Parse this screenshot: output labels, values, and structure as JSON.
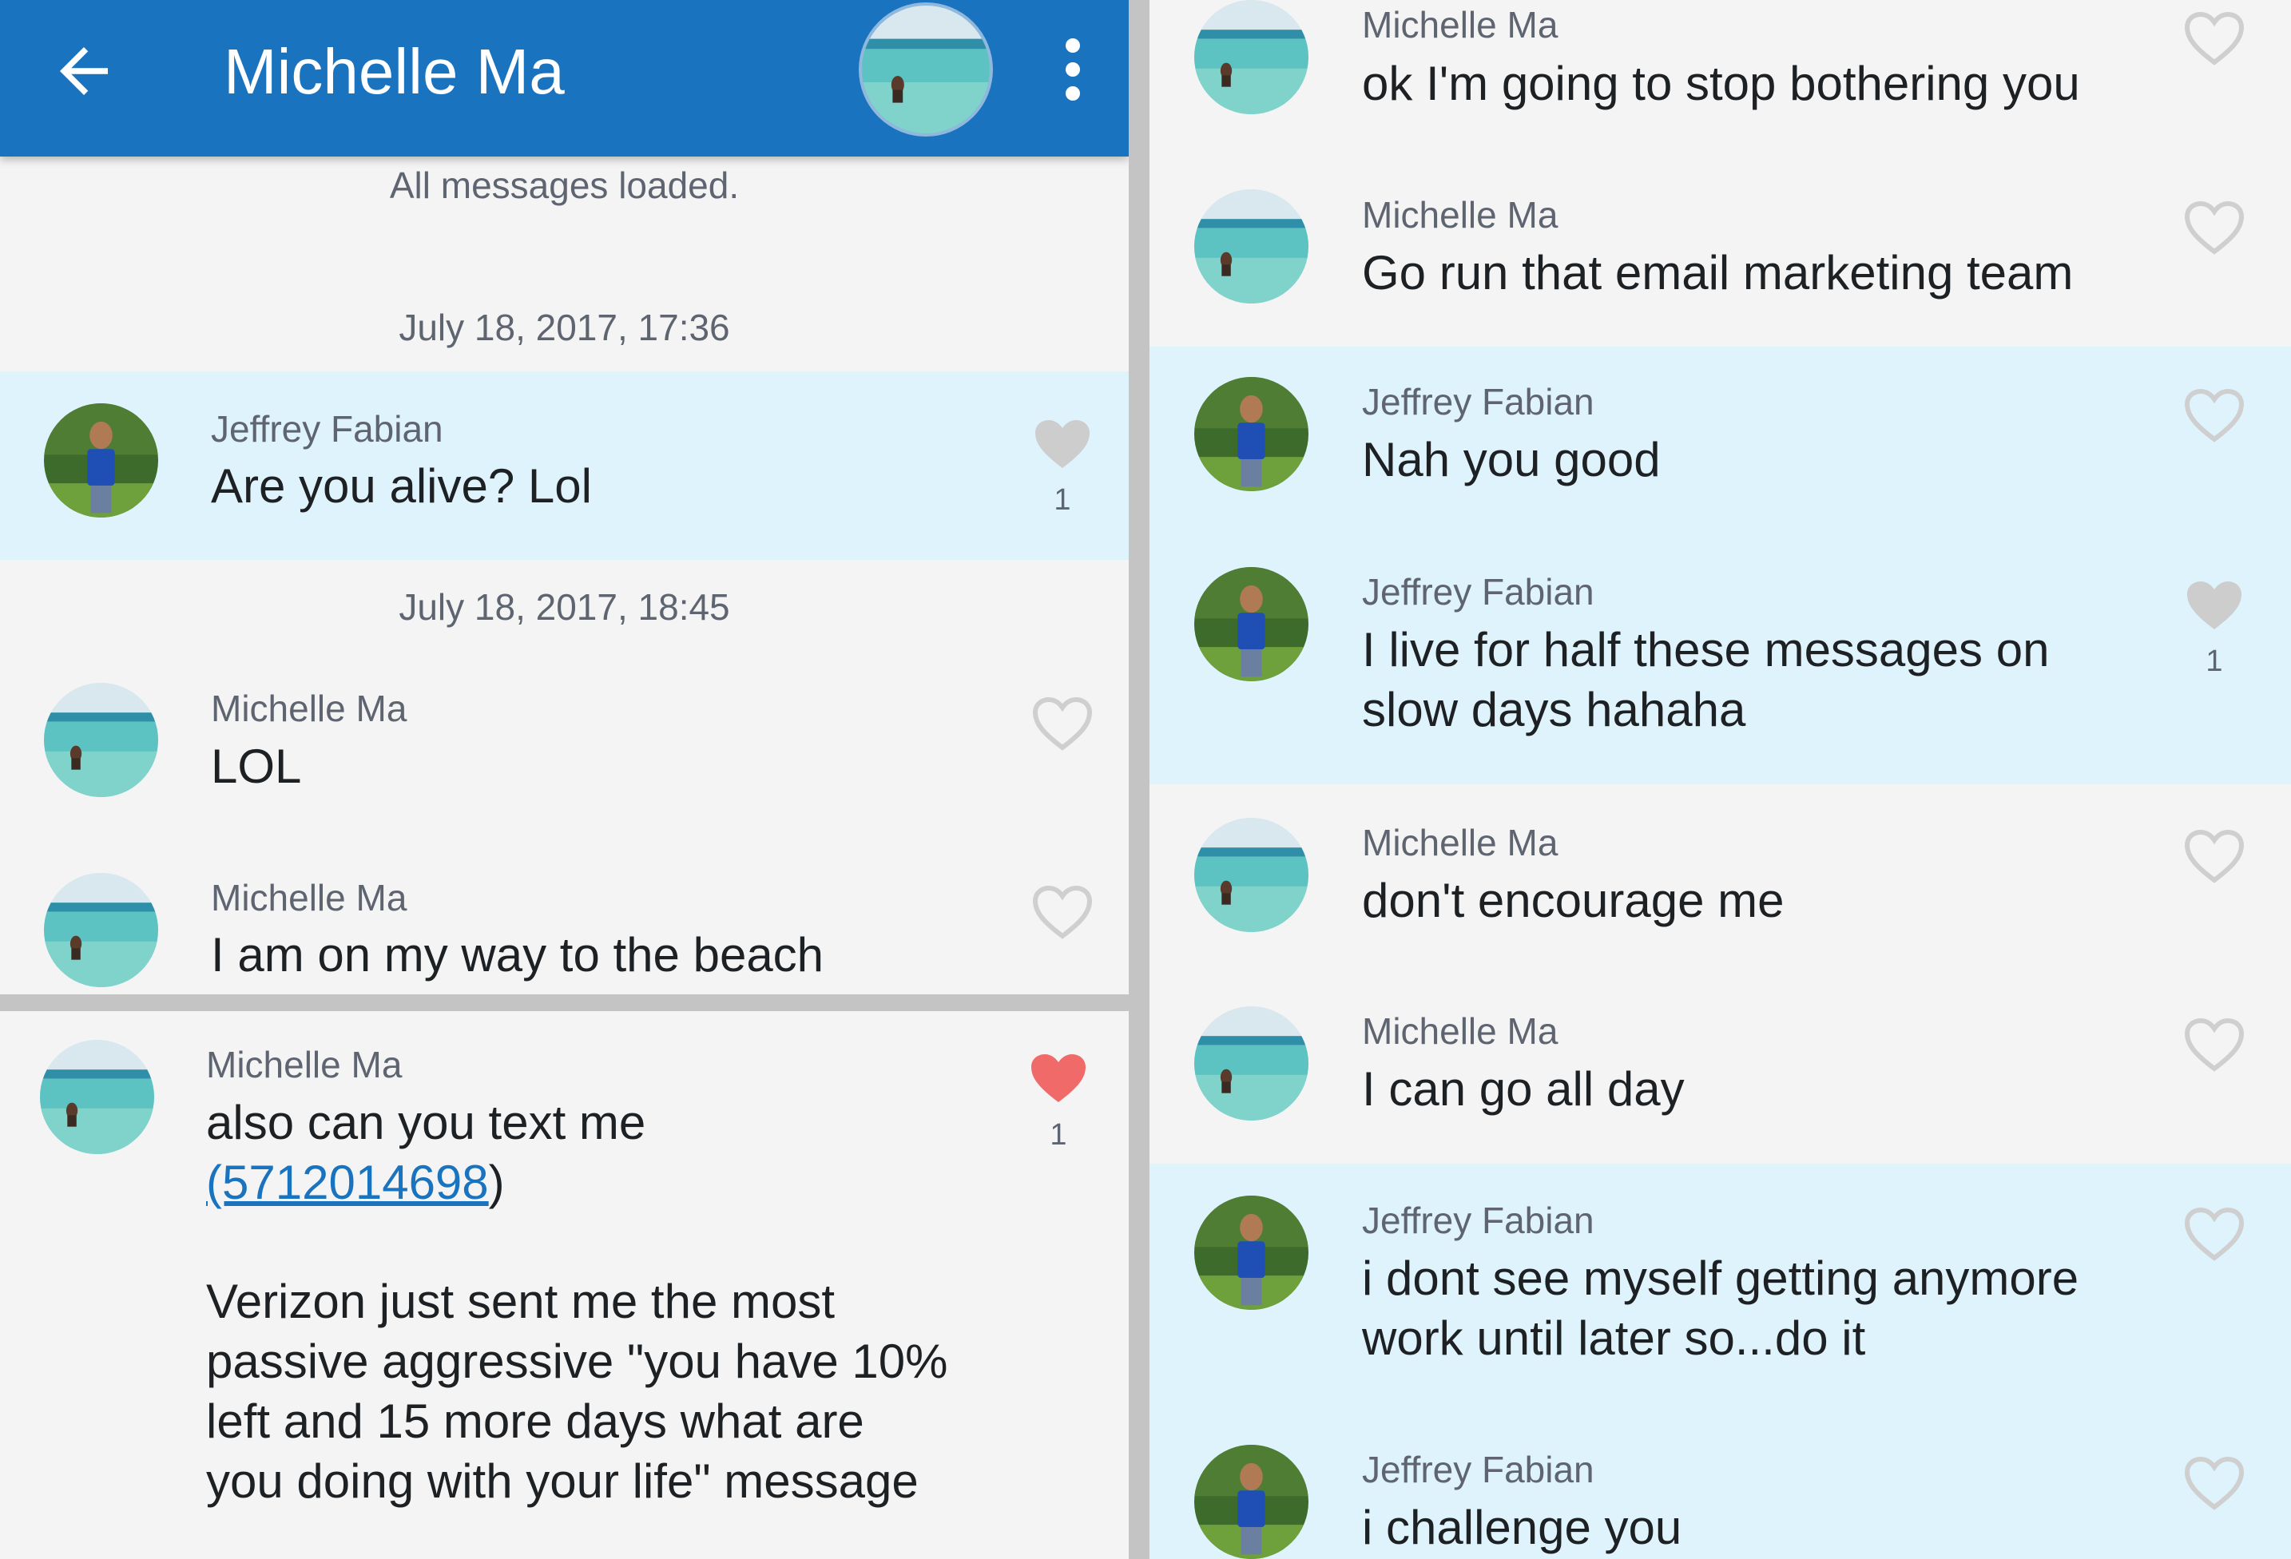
{
  "header": {
    "title": "Michelle Ma",
    "back_label": "back",
    "more_label": "more options"
  },
  "status": {
    "all_loaded": "All messages loaded."
  },
  "dates": {
    "d1": "July 18, 2017, 17:36",
    "d2": "July 18, 2017, 18:45"
  },
  "panel1": {
    "m1": {
      "sender": "Jeffrey Fabian",
      "text": "Are you alive? Lol",
      "likes": "1",
      "liked": "grey-filled"
    },
    "m2": {
      "sender": "Michelle Ma",
      "text": "LOL"
    },
    "m3": {
      "sender": "Michelle Ma",
      "text": "I am on my way to the beach"
    }
  },
  "panel2": {
    "m1": {
      "sender": "Michelle Ma",
      "line1": "also can you text me",
      "phone": "(5712014698",
      "phone_close": ")",
      "line3": "Verizon just sent me the most",
      "line4": "passive aggressive \"you have 10%",
      "line5": "left and 15 more days what are",
      "line6": "you doing with your life\" message",
      "likes": "1",
      "liked": "red-filled"
    }
  },
  "panel3": {
    "m1": {
      "sender": "Michelle Ma",
      "text": "ok I'm going to stop bothering you"
    },
    "m2": {
      "sender": "Michelle Ma",
      "text": "Go run that email marketing team"
    },
    "m3": {
      "sender": "Jeffrey Fabian",
      "text": "Nah you good"
    },
    "m4": {
      "sender": "Jeffrey Fabian",
      "line1": "I live for half these messages on",
      "line2": "slow days hahaha",
      "likes": "1",
      "liked": "grey-filled"
    },
    "m5": {
      "sender": "Michelle Ma",
      "text": "don't encourage me"
    },
    "m6": {
      "sender": "Michelle Ma",
      "text": "I can go all day"
    },
    "m7": {
      "sender": "Jeffrey Fabian",
      "line1": "i dont see myself getting anymore",
      "line2": "work until later so...do it"
    },
    "m8": {
      "sender": "Jeffrey Fabian",
      "text": "i challenge you"
    }
  },
  "colors": {
    "appbar": "#1a73be",
    "highlight": "#dff3fd",
    "heart_red": "#f16a6a",
    "heart_grey": "#c9c9c9"
  },
  "icons": [
    "arrow-left-icon",
    "more-vert-icon",
    "heart-outline-icon",
    "heart-filled-icon"
  ]
}
